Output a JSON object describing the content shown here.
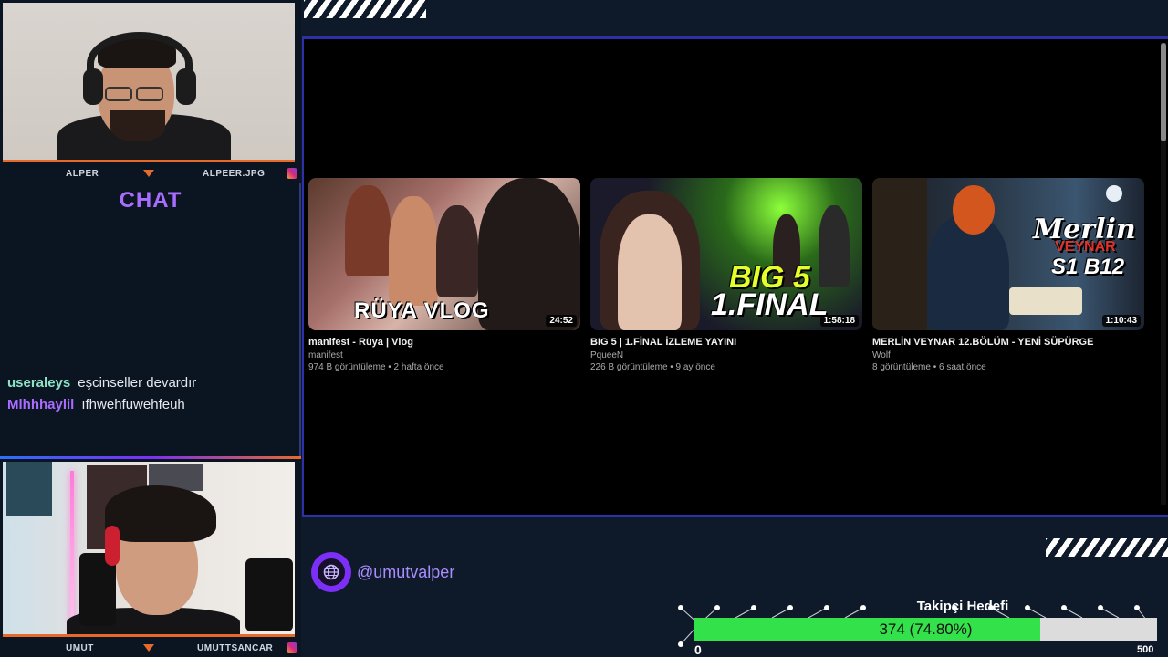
{
  "webcams": {
    "top": {
      "name": "ALPER",
      "handle": "ALPEER.JPG"
    },
    "bottom": {
      "name": "UMUT",
      "handle": "UMUTTSANCAR"
    }
  },
  "chat": {
    "title": "CHAT",
    "messages": [
      {
        "user": "useraleys",
        "user_color": "#8de3c7",
        "text": "eşcinseller devardır"
      },
      {
        "user": "Mlhhhaylil",
        "user_color": "#a86cff",
        "text": "ıfhwehfuwehfeuh"
      }
    ]
  },
  "videos": [
    {
      "thumb_text": "RÜYA VLOG",
      "duration": "24:52",
      "title": "manifest - Rüya | Vlog",
      "channel": "manifest",
      "meta": "974 B görüntüleme • 2 hafta önce"
    },
    {
      "thumb_text_1": "BIG 5",
      "thumb_text_2": "1.FINAL",
      "duration": "1:58:18",
      "title": "BIG 5 | 1.FİNAL İZLEME YAYINI",
      "channel": "PqueeN",
      "meta": "226 B görüntüleme • 9 ay önce"
    },
    {
      "thumb_text_1": "Merlin",
      "thumb_text_2": "VEYNAR",
      "thumb_text_3": "S1 B12",
      "duration": "1:10:43",
      "title": "MERLİN VEYNAR 12.BÖLÜM - YENİ SÜPÜRGE",
      "channel": "Wolf",
      "meta": "8 görüntüleme • 6 saat önce"
    }
  ],
  "social": {
    "handle": "@umutvalper",
    "icon": "globe-icon"
  },
  "follower_goal": {
    "label": "Takipçi Hedefi",
    "current": 374,
    "target": 500,
    "progress_fraction": 0.748,
    "display": "374 (74.80%)",
    "min_label": "0",
    "max_label": "500"
  },
  "colors": {
    "accent_purple": "#a86cff",
    "accent_orange": "#e86a2a",
    "progress_green": "#33e14a",
    "frame_blue": "#2f2fa8"
  }
}
